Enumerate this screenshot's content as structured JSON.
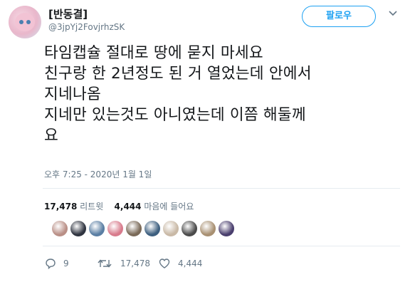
{
  "user": {
    "name": "[반동결]",
    "handle": "@3jpYj2FovjrhzSK",
    "avatar_icon": "jigglypuff-avatar"
  },
  "follow_button": {
    "label": "팔로우"
  },
  "tweet": {
    "lines": [
      "타임캡슐 절대로 땅에 묻지 마세요",
      "친구랑 한 2년정도 된 거 열었는데 안에서",
      "지네나옴",
      "지네만 있는것도 아니였는데 이쯤 해둘께",
      "요"
    ],
    "timestamp": "오후 7:25 - 2020년 1월 1일"
  },
  "stats": {
    "retweets_count": "17,478",
    "retweets_label": "리트윗",
    "likes_count": "4,444",
    "likes_label": "마음에 들어요"
  },
  "likers": {
    "count": 10,
    "colors": [
      "#b98f86",
      "#2f3440",
      "#5a7ea3",
      "#d87b8c",
      "#7a6a58",
      "#3d5f7f",
      "#c9b9a6",
      "#4b4b4b",
      "#a89072",
      "#4a3f6e"
    ]
  },
  "actions": {
    "reply": {
      "icon": "reply-icon",
      "count": "9"
    },
    "retweet": {
      "icon": "retweet-icon",
      "count": "17,478"
    },
    "like": {
      "icon": "heart-icon",
      "count": "4,444"
    }
  },
  "colors": {
    "accent": "#1da1f2",
    "muted": "#657786",
    "text": "#14171a"
  }
}
